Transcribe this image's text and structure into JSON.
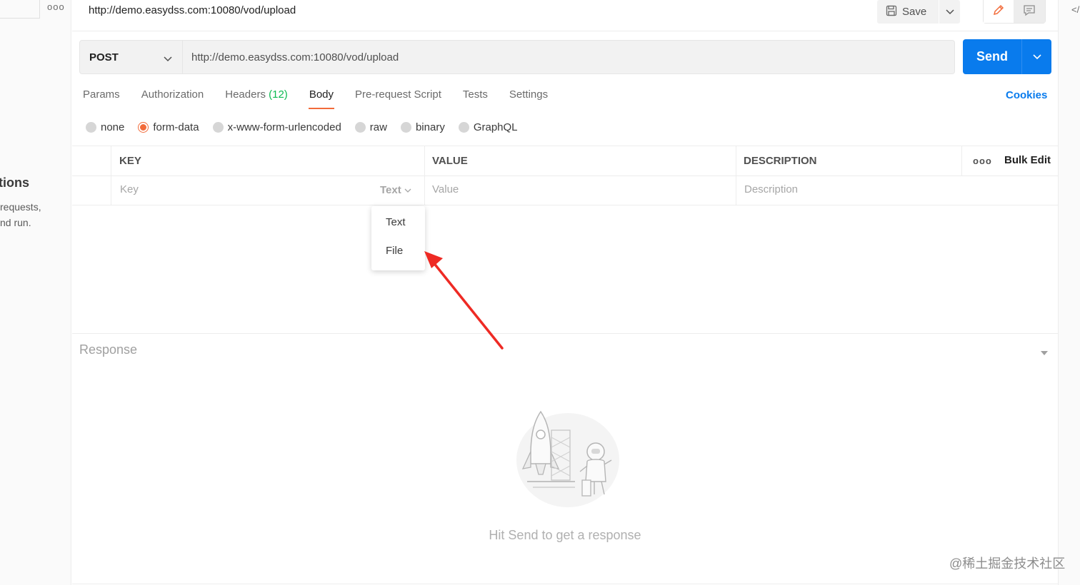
{
  "sidebar": {
    "more_label": "ooo",
    "heading": "tions",
    "desc_line1": "requests,",
    "desc_line2": "nd run."
  },
  "request": {
    "title": "http://demo.easydss.com:10080/vod/upload",
    "method": "POST",
    "url": "http://demo.easydss.com:10080/vod/upload",
    "save_label": "Save",
    "send_label": "Send"
  },
  "tabs": [
    {
      "label": "Params"
    },
    {
      "label": "Authorization"
    },
    {
      "label": "Headers",
      "count": "(12)"
    },
    {
      "label": "Body"
    },
    {
      "label": "Pre-request Script"
    },
    {
      "label": "Tests"
    },
    {
      "label": "Settings"
    }
  ],
  "cookies_label": "Cookies",
  "body_types": [
    {
      "label": "none"
    },
    {
      "label": "form-data"
    },
    {
      "label": "x-www-form-urlencoded"
    },
    {
      "label": "raw"
    },
    {
      "label": "binary"
    },
    {
      "label": "GraphQL"
    }
  ],
  "selected_body_type": "form-data",
  "table": {
    "headers": {
      "key": "KEY",
      "value": "VALUE",
      "description": "DESCRIPTION"
    },
    "more_label": "ooo",
    "bulk_edit": "Bulk Edit",
    "placeholders": {
      "key": "Key",
      "value": "Value",
      "description": "Description"
    },
    "type_selected": "Text"
  },
  "type_menu": {
    "options": [
      "Text",
      "File"
    ]
  },
  "response": {
    "title": "Response",
    "empty_message": "Hit Send to get a response"
  },
  "watermark": "@稀土掘金技术社区",
  "colors": {
    "accent_blue": "#097bed",
    "tab_underline": "#f26b3a",
    "count_green": "#0cbb52",
    "annotation_arrow": "#ee2a24"
  },
  "icons": {
    "save": "floppy-disk-icon",
    "edit": "pencil-icon",
    "comment": "comment-icon",
    "code": "code-icon"
  }
}
